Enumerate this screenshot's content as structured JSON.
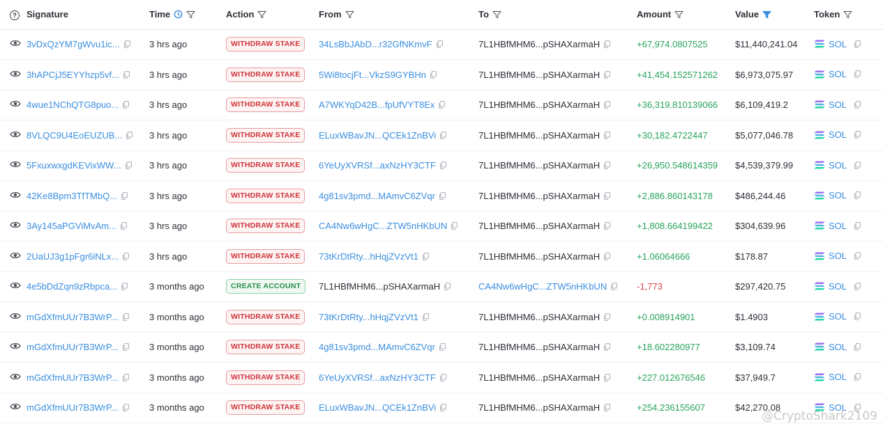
{
  "headers": {
    "info": "?",
    "signature": "Signature",
    "time": "Time",
    "action": "Action",
    "from": "From",
    "to": "To",
    "amount": "Amount",
    "value": "Value",
    "token": "Token"
  },
  "colors": {
    "link": "#3a8ee0",
    "positive": "#27a35a",
    "negative": "#d9434a",
    "withdraw_badge": "#d0343a",
    "create_badge": "#2c8f4e"
  },
  "rows": [
    {
      "signature": "3vDxQzYM7gWvu1ic...",
      "time": "3 hrs ago",
      "action": "WITHDRAW STAKE",
      "action_type": "withdraw",
      "from": "34LsBbJAbD...r32GfNKmvF",
      "from_link": true,
      "to": "7L1HBfMHM6...pSHAXarmaH",
      "to_link": false,
      "amount": "+67,974.0807525",
      "amount_sign": "pos",
      "value": "$11,440,241.04",
      "token": "SOL"
    },
    {
      "signature": "3hAPCjJ5EYYhzp5vf...",
      "time": "3 hrs ago",
      "action": "WITHDRAW STAKE",
      "action_type": "withdraw",
      "from": "5Wi8tocjFt...VkzS9GYBHn",
      "from_link": true,
      "to": "7L1HBfMHM6...pSHAXarmaH",
      "to_link": false,
      "amount": "+41,454.152571262",
      "amount_sign": "pos",
      "value": "$6,973,075.97",
      "token": "SOL"
    },
    {
      "signature": "4wue1NChQTG8puo...",
      "time": "3 hrs ago",
      "action": "WITHDRAW STAKE",
      "action_type": "withdraw",
      "from": "A7WKYqD42B...fpUfVYT8Ex",
      "from_link": true,
      "to": "7L1HBfMHM6...pSHAXarmaH",
      "to_link": false,
      "amount": "+36,319.810139066",
      "amount_sign": "pos",
      "value": "$6,109,419.2",
      "token": "SOL"
    },
    {
      "signature": "8VLQC9U4EoEUZUB...",
      "time": "3 hrs ago",
      "action": "WITHDRAW STAKE",
      "action_type": "withdraw",
      "from": "ELuxWBavJN...QCEk1ZnBVi",
      "from_link": true,
      "to": "7L1HBfMHM6...pSHAXarmaH",
      "to_link": false,
      "amount": "+30,182.4722447",
      "amount_sign": "pos",
      "value": "$5,077,046.78",
      "token": "SOL"
    },
    {
      "signature": "5FxuxwxgdKEVixWW...",
      "time": "3 hrs ago",
      "action": "WITHDRAW STAKE",
      "action_type": "withdraw",
      "from": "6YeUyXVRSf...axNzHY3CTF",
      "from_link": true,
      "to": "7L1HBfMHM6...pSHAXarmaH",
      "to_link": false,
      "amount": "+26,950.548614359",
      "amount_sign": "pos",
      "value": "$4,539,379.99",
      "token": "SOL"
    },
    {
      "signature": "42Ke8Bpm3TfTMbQ...",
      "time": "3 hrs ago",
      "action": "WITHDRAW STAKE",
      "action_type": "withdraw",
      "from": "4g81sv3pmd...MAmvC6ZVqr",
      "from_link": true,
      "to": "7L1HBfMHM6...pSHAXarmaH",
      "to_link": false,
      "amount": "+2,886.860143178",
      "amount_sign": "pos",
      "value": "$486,244.46",
      "token": "SOL"
    },
    {
      "signature": "3Ay145aPGViMvAm...",
      "time": "3 hrs ago",
      "action": "WITHDRAW STAKE",
      "action_type": "withdraw",
      "from": "CA4Nw6wHgC...ZTW5nHKbUN",
      "from_link": true,
      "to": "7L1HBfMHM6...pSHAXarmaH",
      "to_link": false,
      "amount": "+1,808.664199422",
      "amount_sign": "pos",
      "value": "$304,639.96",
      "token": "SOL"
    },
    {
      "signature": "2UaUJ3g1pFgr6iNLx...",
      "time": "3 hrs ago",
      "action": "WITHDRAW STAKE",
      "action_type": "withdraw",
      "from": "73tKrDtRty...hHqjZVzVt1",
      "from_link": true,
      "to": "7L1HBfMHM6...pSHAXarmaH",
      "to_link": false,
      "amount": "+1.06064666",
      "amount_sign": "pos",
      "value": "$178.87",
      "token": "SOL"
    },
    {
      "signature": "4e5bDdZqn9zRbpca...",
      "time": "3 months ago",
      "action": "CREATE ACCOUNT",
      "action_type": "create",
      "from": "7L1HBfMHM6...pSHAXarmaH",
      "from_link": false,
      "to": "CA4Nw6wHgC...ZTW5nHKbUN",
      "to_link": true,
      "amount": "-1,773",
      "amount_sign": "neg",
      "value": "$297,420.75",
      "token": "SOL"
    },
    {
      "signature": "mGdXfmUUr7B3WrP...",
      "time": "3 months ago",
      "action": "WITHDRAW STAKE",
      "action_type": "withdraw",
      "from": "73tKrDtRty...hHqjZVzVt1",
      "from_link": true,
      "to": "7L1HBfMHM6...pSHAXarmaH",
      "to_link": false,
      "amount": "+0.008914901",
      "amount_sign": "pos",
      "value": "$1.4903",
      "token": "SOL"
    },
    {
      "signature": "mGdXfmUUr7B3WrP...",
      "time": "3 months ago",
      "action": "WITHDRAW STAKE",
      "action_type": "withdraw",
      "from": "4g81sv3pmd...MAmvC6ZVqr",
      "from_link": true,
      "to": "7L1HBfMHM6...pSHAXarmaH",
      "to_link": false,
      "amount": "+18.602280977",
      "amount_sign": "pos",
      "value": "$3,109.74",
      "token": "SOL"
    },
    {
      "signature": "mGdXfmUUr7B3WrP...",
      "time": "3 months ago",
      "action": "WITHDRAW STAKE",
      "action_type": "withdraw",
      "from": "6YeUyXVRSf...axNzHY3CTF",
      "from_link": true,
      "to": "7L1HBfMHM6...pSHAXarmaH",
      "to_link": false,
      "amount": "+227.012676546",
      "amount_sign": "pos",
      "value": "$37,949.7",
      "token": "SOL"
    },
    {
      "signature": "mGdXfmUUr7B3WrP...",
      "time": "3 months ago",
      "action": "WITHDRAW STAKE",
      "action_type": "withdraw",
      "from": "ELuxWBavJN...QCEk1ZnBVi",
      "from_link": true,
      "to": "7L1HBfMHM6...pSHAXarmaH",
      "to_link": false,
      "amount": "+254.236155607",
      "amount_sign": "pos",
      "value": "$42,270.08",
      "token": "SOL"
    }
  ],
  "watermark": "@CryptoShark2109"
}
